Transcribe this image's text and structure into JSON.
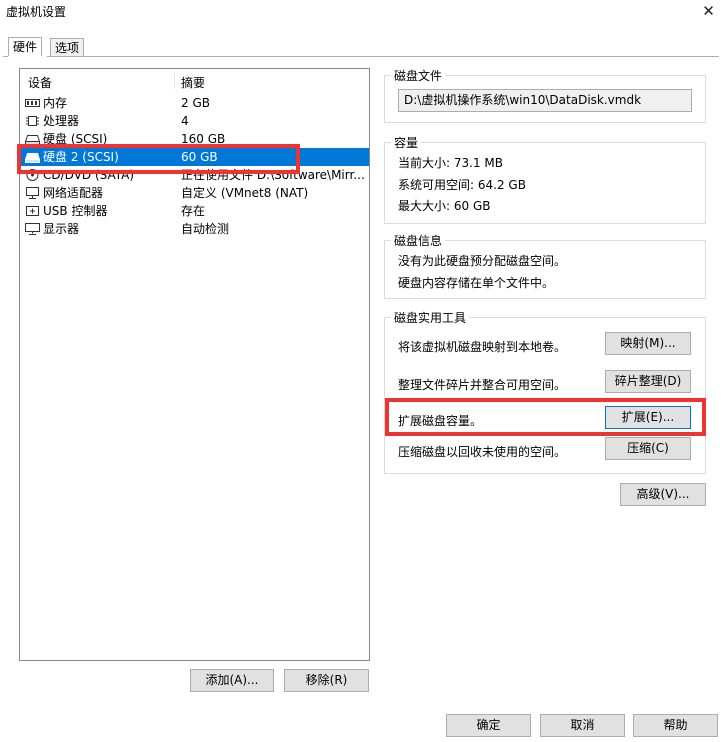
{
  "window": {
    "title": "虚拟机设置",
    "close_glyph": "✕"
  },
  "tabs": [
    {
      "label": "硬件"
    },
    {
      "label": "选项"
    }
  ],
  "devices": {
    "header": {
      "device": "设备",
      "summary": "摘要"
    },
    "rows": [
      {
        "name": "内存",
        "summary": "2 GB",
        "icon": "memory-icon"
      },
      {
        "name": "处理器",
        "summary": "4",
        "icon": "cpu-icon"
      },
      {
        "name": "硬盘 (SCSI)",
        "summary": "160 GB",
        "icon": "hard-disk-icon"
      },
      {
        "name": "硬盘 2 (SCSI)",
        "summary": "60 GB",
        "icon": "hard-disk-icon"
      },
      {
        "name": "CD/DVD (SATA)",
        "summary": "正在使用文件 D:\\Software\\Mirr...",
        "icon": "cd-dvd-icon"
      },
      {
        "name": "网络适配器",
        "summary": "自定义 (VMnet8 (NAT)",
        "icon": "network-icon"
      },
      {
        "name": "USB 控制器",
        "summary": "存在",
        "icon": "usb-icon"
      },
      {
        "name": "显示器",
        "summary": "自动检测",
        "icon": "monitor-icon"
      }
    ],
    "add_label": "添加(A)...",
    "remove_label": "移除(R)"
  },
  "disk_file": {
    "legend": "磁盘文件",
    "path": "D:\\虚拟机操作系统\\win10\\DataDisk.vmdk"
  },
  "capacity": {
    "legend": "容量",
    "current": "当前大小: 73.1 MB",
    "available": "系统可用空间: 64.2 GB",
    "max": "最大大小: 60 GB"
  },
  "disk_info": {
    "legend": "磁盘信息",
    "line1": "没有为此硬盘预分配磁盘空间。",
    "line2": "硬盘内容存储在单个文件中。"
  },
  "utilities": {
    "legend": "磁盘实用工具",
    "map_text": "将该虚拟机磁盘映射到本地卷。",
    "map_button": "映射(M)...",
    "defrag_text": "整理文件碎片并整合可用空间。",
    "defrag_button": "碎片整理(D)",
    "expand_text": "扩展磁盘容量。",
    "expand_button": "扩展(E)...",
    "compact_text": "压缩磁盘以回收未使用的空间。",
    "compact_button": "压缩(C)"
  },
  "advanced_button": "高级(V)...",
  "footer": {
    "ok": "确定",
    "cancel": "取消",
    "help": "帮助"
  },
  "colors": {
    "selection": "#0078d7",
    "highlight": "#ee3333"
  }
}
